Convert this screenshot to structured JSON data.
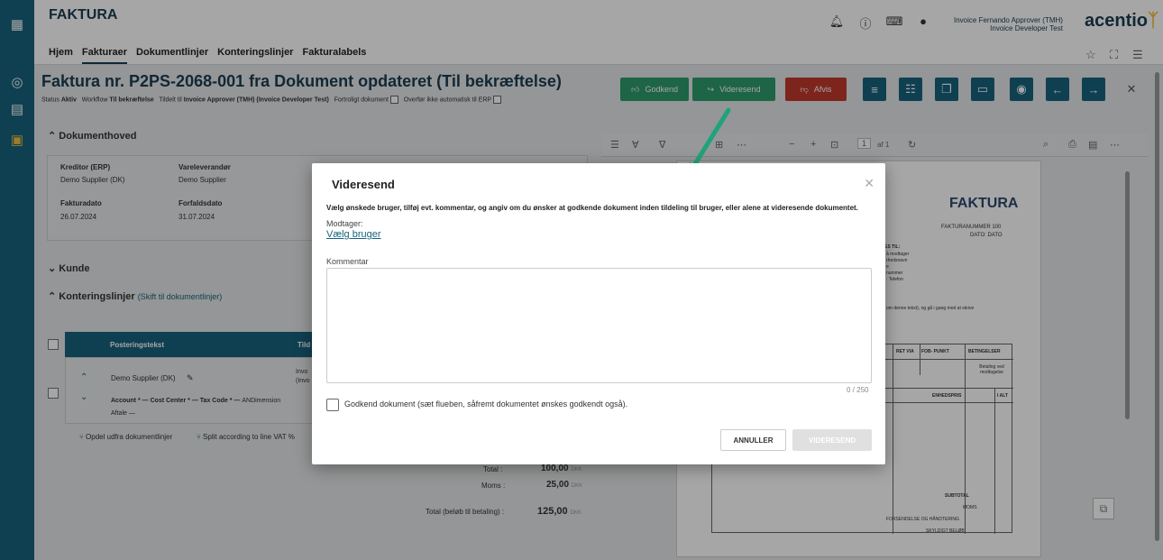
{
  "app": {
    "title": "FAKTURA",
    "brand": "acentio",
    "user_line1": "Invoice Fernando Approver (TMH)",
    "user_line2": "Invoice Developer Test"
  },
  "topnav": [
    "Hjem",
    "Fakturaer",
    "Dokumentlinjer",
    "Konteringslinjer",
    "Fakturalabels"
  ],
  "invoice": {
    "title": "Faktura nr. P2PS-2068-001 fra Dokument opdateret (Til bekræftelse)",
    "status_label": "Status",
    "status_value": "Aktiv",
    "workflow_label": "Workflow",
    "workflow_value": "Til bekræftelse",
    "assigned_label": "Tildelt til",
    "assigned_value": "Invoice Approver (TMH) (Invoice Developer Test)",
    "confidential_label": "Fortroligt dokument",
    "no_transfer_label": "Overfør ikke automatisk til ERP"
  },
  "actions": {
    "approve": "Godkend",
    "forward": "Videresend",
    "reject": "Afvis"
  },
  "doc_header": {
    "section_title": "Dokumenthoved",
    "creditor_label": "Kreditor (ERP)",
    "creditor_value": "Demo Supplier (DK)",
    "supplier_label": "Vareleverandør",
    "supplier_value": "Demo Supplier",
    "invoice_date_label": "Fakturadato",
    "invoice_date_value": "26.07.2024",
    "due_date_label": "Forfaldsdato",
    "due_date_value": "31.07.2024"
  },
  "customer": {
    "section_title": "Kunde"
  },
  "posting": {
    "section_title": "Konteringslinjer",
    "switch_link": "(Skift til dokumentlinjer)",
    "col_text": "Posteringstekst",
    "col_assigned": "Tild",
    "row_supplier": "Demo Supplier (DK)",
    "row_invo": "Invo",
    "row_invo2": "(Invo",
    "row_account": "Account *",
    "row_cost_center": "Cost Center *",
    "row_tax_code": "Tax Code *",
    "row_andimension": "ANDimension",
    "row_aftale": "Aftale",
    "split_doc": "Opdel udfra dokumentlinjer",
    "split_vat": "Split according to line VAT %"
  },
  "totals": {
    "total_label": "Total :",
    "total_value": "100,00",
    "total_currency": "DKK",
    "vat_label": "Moms :",
    "vat_value": "25,00",
    "vat_currency": "DKK",
    "grand_label": "Total (beløb til betaling) :",
    "grand_value": "125,00",
    "grand_currency": "DKK"
  },
  "pdf": {
    "page_current": "1",
    "page_of": "af 1",
    "doc_title": "FAKTURA",
    "doc_number": "FAKTURANUMMER 100",
    "doc_date": "DATO: DATO",
    "ship_to": "ES TIL:",
    "ship_lines": [
      "å modtager",
      "rhedsnavn",
      "e",
      "nummer",
      ": Telefon"
    ],
    "note": "om denne tekst), og gå i gang med at skrive",
    "th_via": "RET VIA",
    "th_fob": "FOB- PUNKT",
    "th_terms": "BETINGELSER",
    "terms_value": "Betaling ved modtagelse",
    "th_unit": "ENHEDSPRIS",
    "th_total": "I ALT",
    "subtotal": "SUBTOTAL",
    "moms": "MOMS",
    "shipping": "FORSENDELSE OG HÅNDTERING",
    "due": "SKYLDIGT BELØB"
  },
  "modal": {
    "title": "Videresend",
    "instruction": "Vælg ønskede bruger, tilføj evt. kommentar, og angiv om du ønsker at godkende dokument inden tildeling til bruger, eller alene at videresende dokumentet.",
    "recipient_label": "Modtager:",
    "recipient_link": "Vælg bruger",
    "comment_label": "Kommentar",
    "comment_value": "",
    "counter": "0 / 250",
    "approve_checkbox_label": "Godkend dokument (sæt flueben, såfremt dokumentet ønskes godkendt også).",
    "cancel": "ANNULLER",
    "submit": "VIDERESEND"
  },
  "colors": {
    "primary": "#17637d",
    "approve": "#2e9c6a",
    "reject": "#c0392b",
    "arrow": "#1fa37c"
  }
}
